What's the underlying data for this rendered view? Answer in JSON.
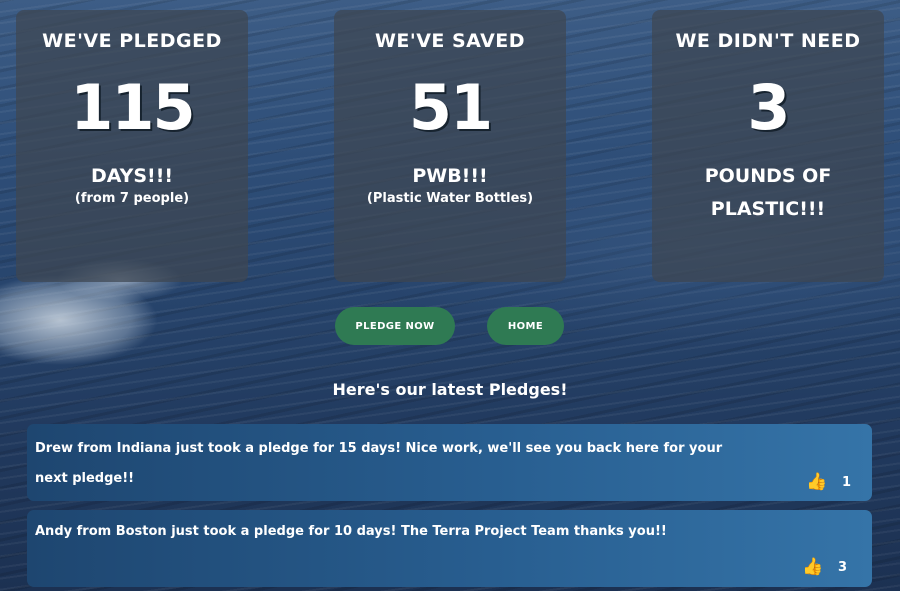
{
  "stats": [
    {
      "title": "WE'VE PLEDGED",
      "number": "115",
      "sub": "DAYS!!!",
      "note": "(from 7 people)"
    },
    {
      "title": "WE'VE SAVED",
      "number": "51",
      "sub": "PWB!!!",
      "note": "(Plastic Water Bottles)"
    },
    {
      "title": "WE DIDN'T NEED",
      "number": "3",
      "sub": "POUNDS OF PLASTIC!!!",
      "note": ""
    }
  ],
  "buttons": {
    "pledge_now": "PLEDGE NOW",
    "home": "HOME"
  },
  "latest": {
    "heading": "Here's our latest Pledges!",
    "pledges": [
      {
        "text": "Drew from Indiana just took a pledge for 15 days! Nice work, we'll see you back here for your next pledge!!",
        "like_icon": "thumbs-up-icon",
        "likes": "1"
      },
      {
        "text": "Andy from Boston just took a pledge for 10 days! The Terra Project Team thanks you!!",
        "like_icon": "thumbs-up-icon",
        "likes": "3"
      }
    ]
  },
  "colors": {
    "button_green": "#2f7a53",
    "card_overlay": "#3e4652",
    "pledge_card_start": "#1e4670",
    "pledge_card_end": "#3574a8"
  }
}
